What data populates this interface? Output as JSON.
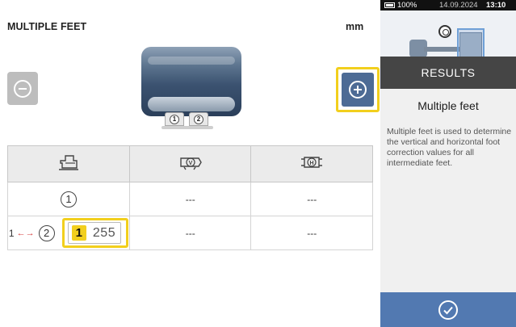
{
  "header": {
    "title": "MULTIPLE FEET",
    "unit": "mm"
  },
  "controls": {
    "remove_icon": "minus-circle-icon",
    "add_icon": "plus-circle-icon"
  },
  "machine": {
    "feet": [
      "1",
      "2"
    ]
  },
  "table": {
    "header_icons": [
      "foot-position-icon",
      "vertical-correction-icon",
      "horizontal-correction-icon"
    ],
    "rows": [
      {
        "foot": "1",
        "prefix": "",
        "vertical": "---",
        "horizontal": "---"
      },
      {
        "foot": "2",
        "prefix": "1",
        "distance_ref": "1",
        "distance": "255",
        "vertical": "---",
        "horizontal": "---"
      }
    ]
  },
  "status_bar": {
    "battery": "100%",
    "date": "14.09.2024",
    "time": "13:10"
  },
  "side": {
    "section": "RESULTS",
    "help_title": "Multiple feet",
    "help_text": "Multiple feet is used to determine the vertical and horizontal foot correction values for all intermediate feet.",
    "confirm_icon": "check-circle-icon"
  },
  "colors": {
    "accent_yellow": "#f2cf1d",
    "button_blue": "#4d6b95",
    "confirm_blue": "#5279b1",
    "results_bar": "#454545"
  }
}
